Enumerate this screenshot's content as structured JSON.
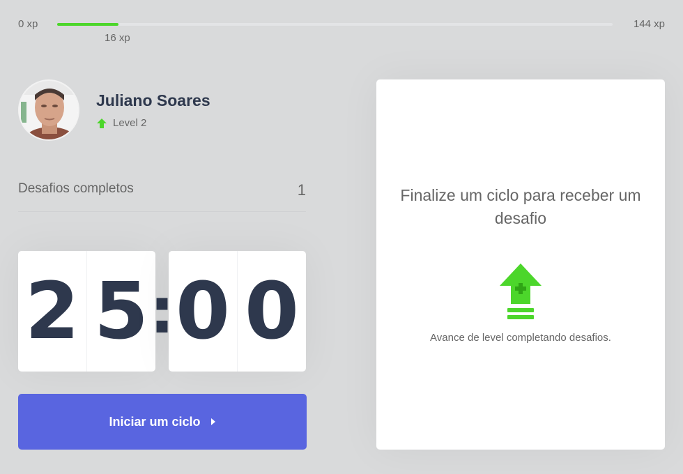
{
  "xp": {
    "min_label": "0 xp",
    "max_label": "144 xp",
    "current_label": "16 xp",
    "progress_fraction": 0.111
  },
  "profile": {
    "name": "Juliano Soares",
    "level_label": "Level 2"
  },
  "challenges": {
    "completed_label": "Desafios completos",
    "completed_count": "1"
  },
  "countdown": {
    "minute_left": "2",
    "minute_right": "5",
    "separator": ":",
    "second_left": "0",
    "second_right": "0"
  },
  "start_button": {
    "label": "Iniciar um ciclo",
    "icon": "chevron-right-icon"
  },
  "challenge_box": {
    "title": "Finalize um ciclo para receber um desafio",
    "hint": "Avance de level completando desafios.",
    "icon": "level-up-icon"
  },
  "colors": {
    "background": "#d9dadb",
    "accent_green": "#4cd62b",
    "button_blue": "#5965e0",
    "title_dark": "#2e384d",
    "text": "#666666"
  }
}
